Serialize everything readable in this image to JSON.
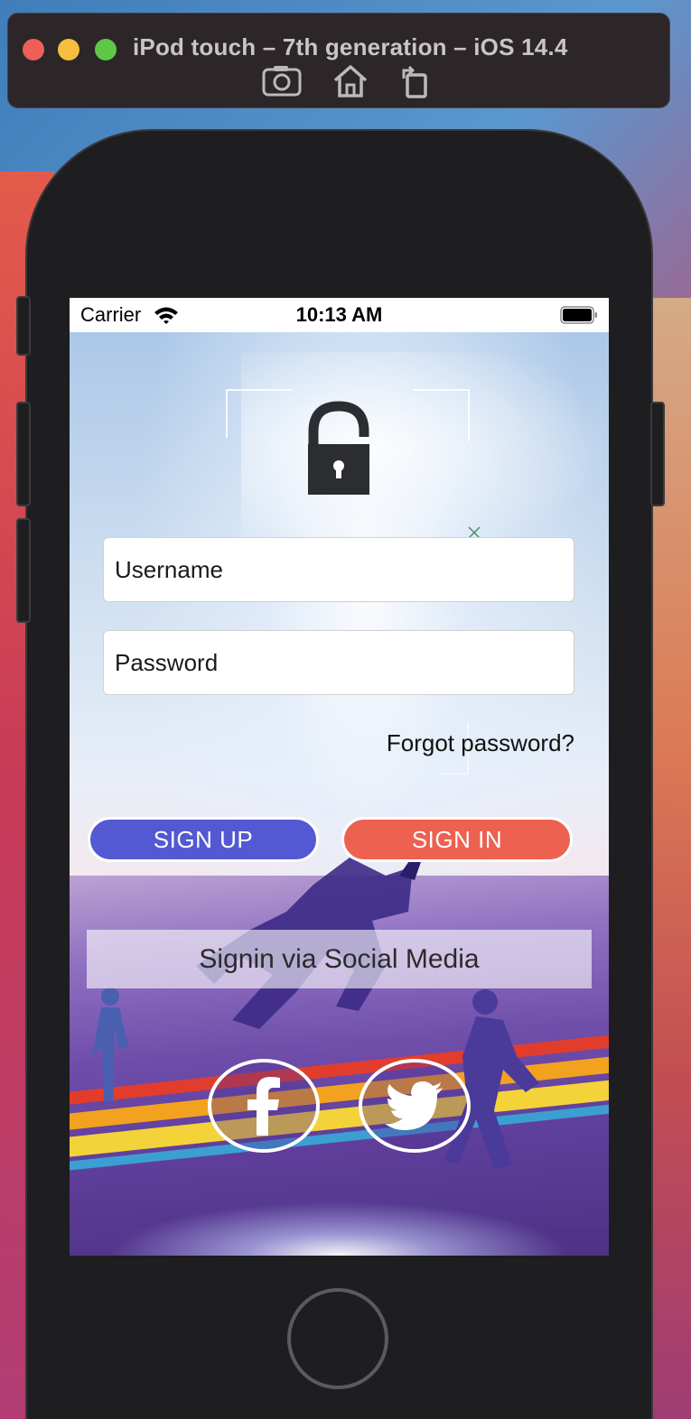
{
  "simulator": {
    "title": "iPod touch – 7th generation – iOS 14.4",
    "tools": [
      "screenshot-icon",
      "home-icon",
      "rotate-icon"
    ]
  },
  "status_bar": {
    "carrier": "Carrier",
    "time": "10:13 AM"
  },
  "login": {
    "username_placeholder": "Username",
    "password_placeholder": "Password",
    "forgot_label": "Forgot password?",
    "signup_label": "SIGN UP",
    "signin_label": "SIGN IN",
    "social_label": "Signin via Social Media"
  },
  "colors": {
    "signup": "#5259d2",
    "signin": "#ec6150"
  }
}
